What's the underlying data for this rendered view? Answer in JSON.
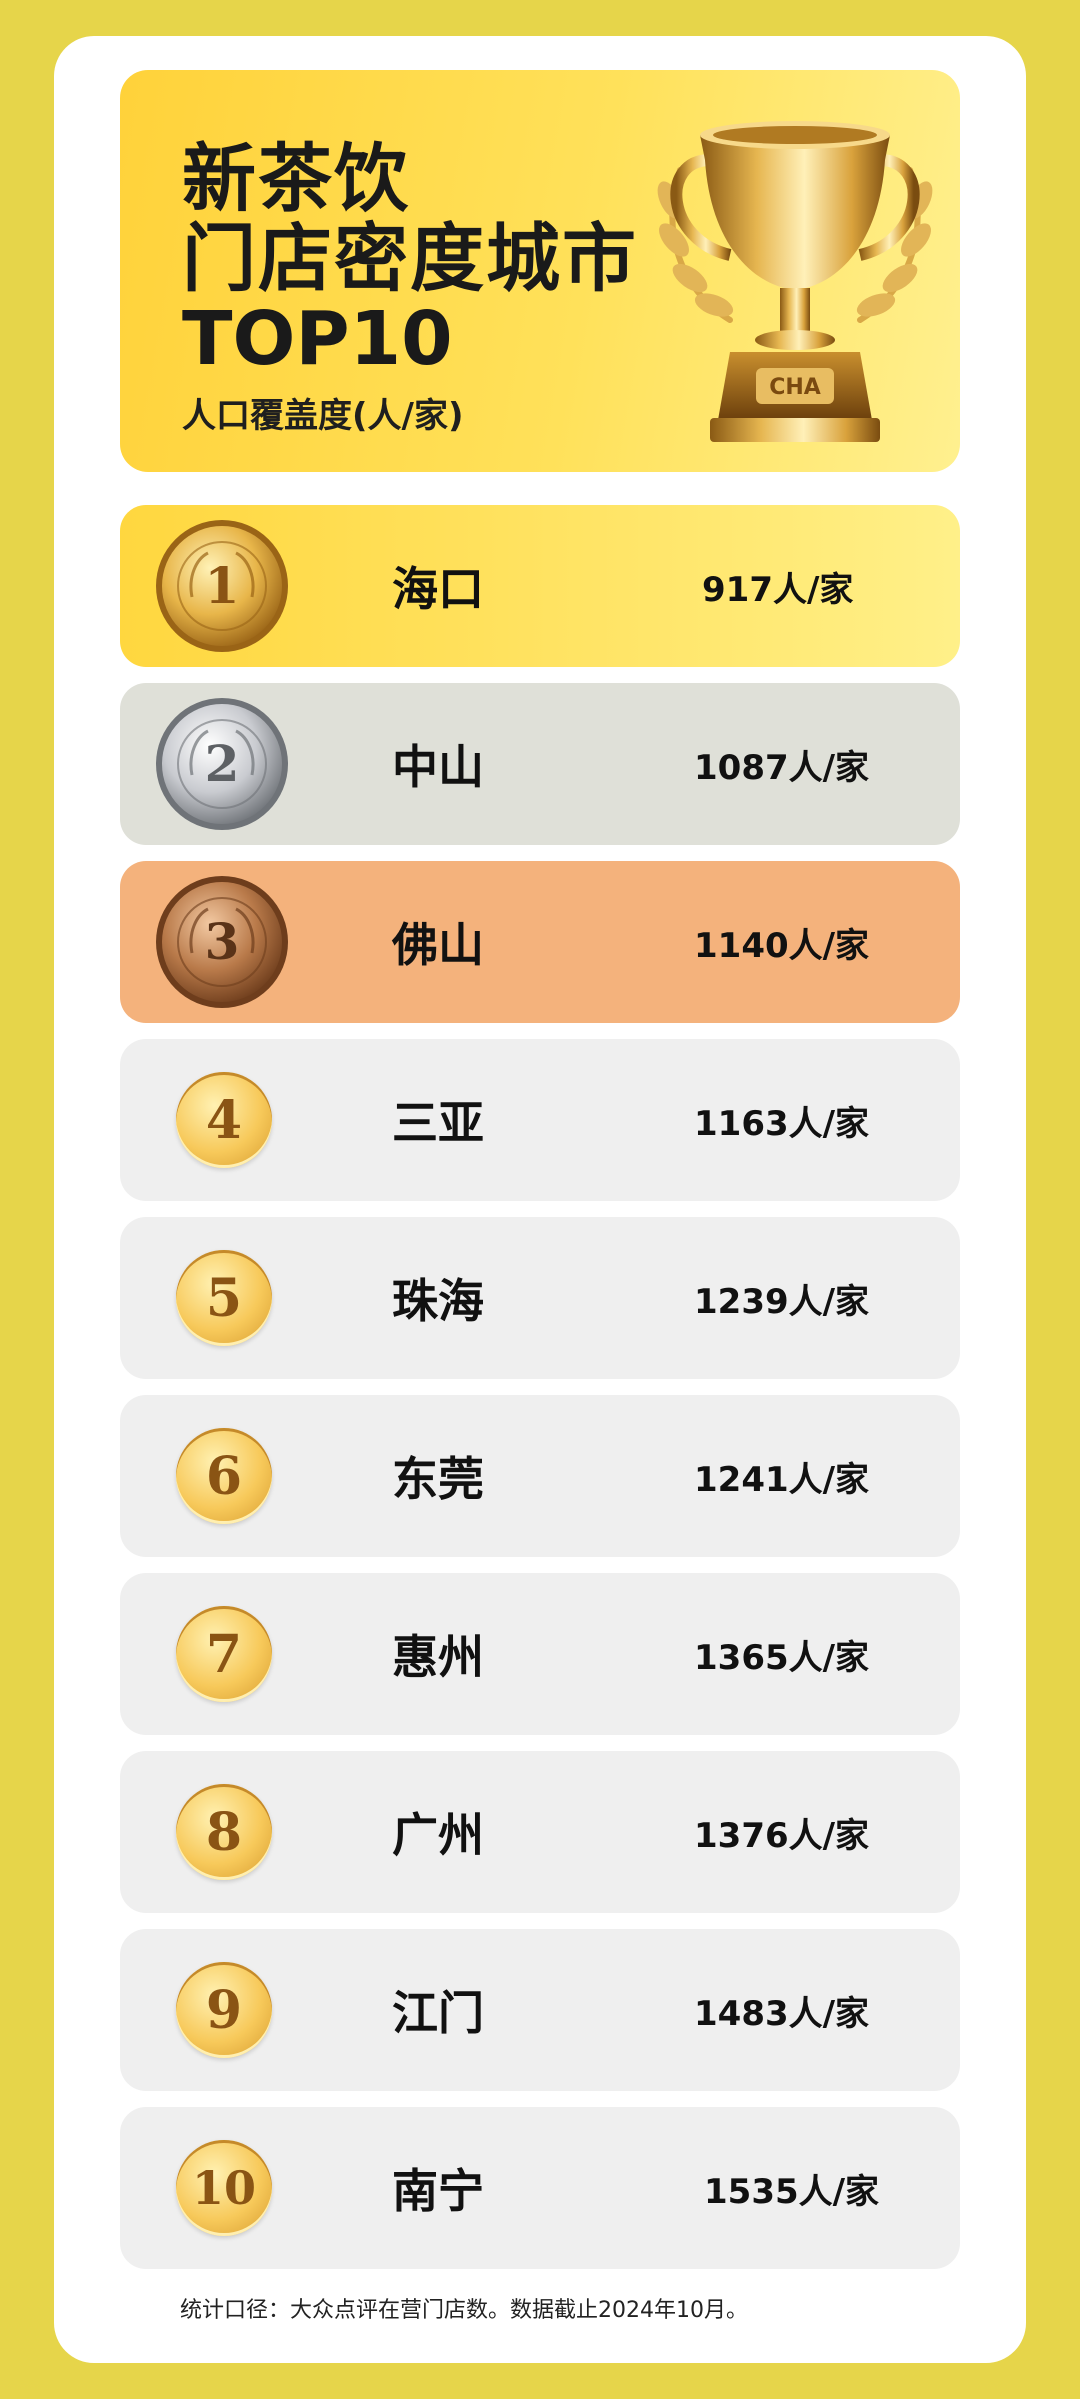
{
  "header": {
    "title_line1": "新茶饮",
    "title_line2": "门店密度城市",
    "title_line3": "TOP10",
    "subtitle": "人口覆盖度(人/家)",
    "trophy_label": "CHA"
  },
  "rankings": [
    {
      "rank": "1",
      "city": "海口",
      "value": "917人/家"
    },
    {
      "rank": "2",
      "city": "中山",
      "value": "1087人/家"
    },
    {
      "rank": "3",
      "city": "佛山",
      "value": "1140人/家"
    },
    {
      "rank": "4",
      "city": "三亚",
      "value": "1163人/家"
    },
    {
      "rank": "5",
      "city": "珠海",
      "value": "1239人/家"
    },
    {
      "rank": "6",
      "city": "东莞",
      "value": "1241人/家"
    },
    {
      "rank": "7",
      "city": "惠州",
      "value": "1365人/家"
    },
    {
      "rank": "8",
      "city": "广州",
      "value": "1376人/家"
    },
    {
      "rank": "9",
      "city": "江门",
      "value": "1483人/家"
    },
    {
      "rank": "10",
      "city": "南宁",
      "value": "1535人/家"
    }
  ],
  "footer": {
    "note": "统计口径：大众点评在营门店数。数据截止2024年10月。"
  },
  "colors": {
    "page_background": "#e6d54a",
    "gold_row": "#ffd73f",
    "silver_row": "#dfe0d8",
    "bronze_row": "#f4b27c",
    "plain_row": "#efefef"
  },
  "icons": {
    "trophy": "trophy-icon",
    "medal_gold": "gold-medal-icon",
    "medal_silver": "silver-medal-icon",
    "medal_bronze": "bronze-medal-icon",
    "rank_badge": "rank-badge-icon"
  }
}
